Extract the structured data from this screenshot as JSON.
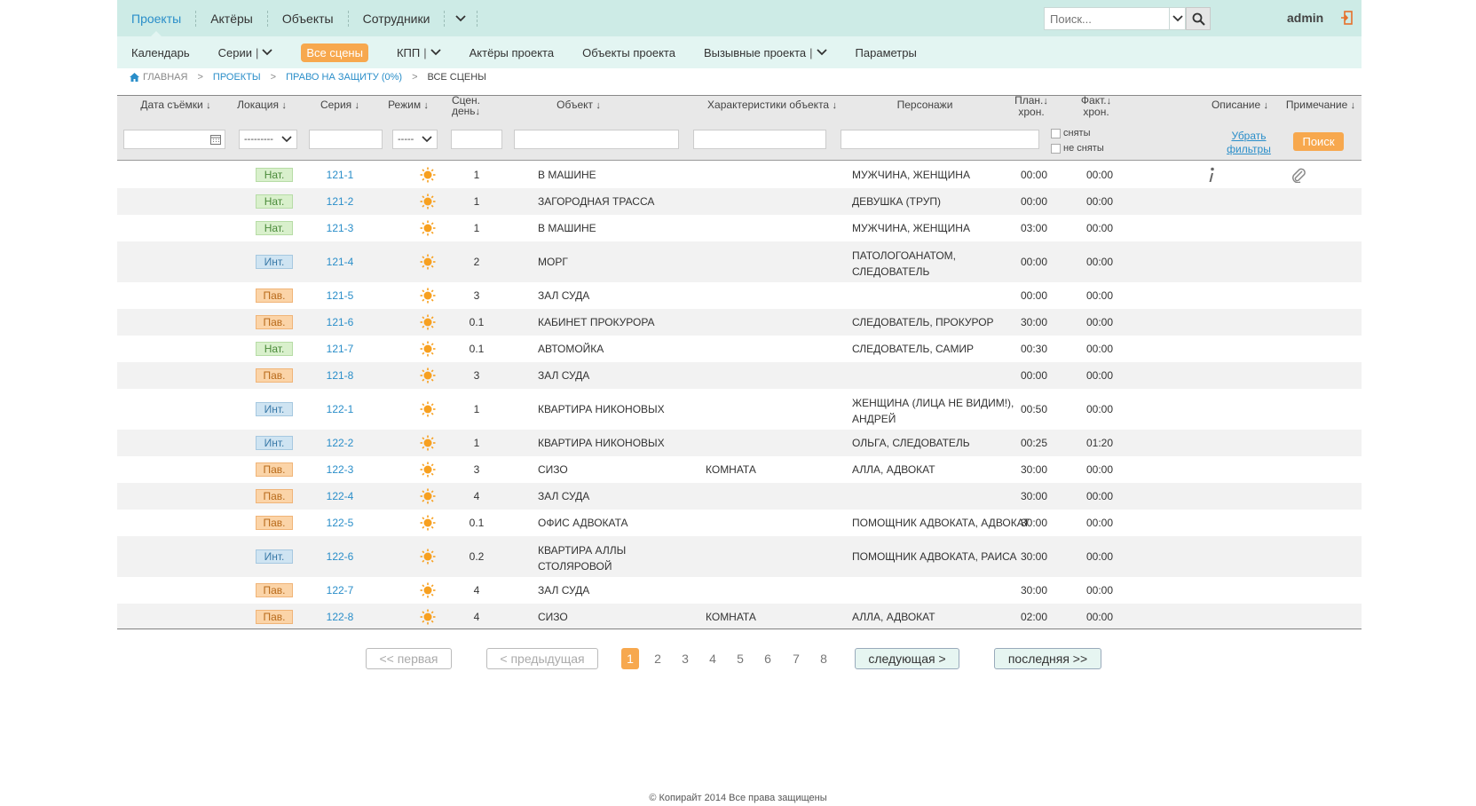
{
  "topnav": {
    "items": [
      "Проекты",
      "Актёры",
      "Объекты",
      "Сотрудники"
    ],
    "search_placeholder": "Поиск...",
    "user": "admin"
  },
  "subnav": {
    "calendar": "Календарь",
    "series": "Серии",
    "all_scenes": "Все сцены",
    "kpp": "КПП",
    "actors": "Актёры проекта",
    "objects": "Объекты проекта",
    "calls": "Вызывные проекта",
    "params": "Параметры"
  },
  "breadcrumb": {
    "home": "ГЛАВНАЯ",
    "projects": "ПРОЕКТЫ",
    "project": "ПРАВО НА ЗАЩИТУ (0%)",
    "current": "ВСЕ СЦЕНЫ"
  },
  "table": {
    "headers": {
      "date": "Дата съёмки",
      "location": "Локация",
      "series": "Серия",
      "mode": "Режим",
      "scene_day_1": "Сцен.",
      "scene_day_2": "день",
      "object": "Объект",
      "object_chars": "Характеристики объекта",
      "characters": "Персонажи",
      "plan_1": "План.",
      "plan_2": "хрон.",
      "fact_1": "Факт.",
      "fact_2": "хрон.",
      "description": "Описание",
      "note": "Примечание"
    },
    "filters": {
      "location_select": "---------",
      "mode_select": "-----",
      "shot": "сняты",
      "not_shot": "не сняты",
      "clear_1": "Убрать",
      "clear_2": "фильтры",
      "search_button": "Поиск"
    },
    "rows": [
      {
        "loc": "Нат.",
        "series": "121-1",
        "day": "1",
        "object": "В МАШИНЕ",
        "object2": "",
        "chars": "",
        "chars_a": "МУЖЧИНА, ЖЕНЩИНА",
        "chars_b": "",
        "plan": "00:00",
        "fact": "00:00"
      },
      {
        "loc": "Нат.",
        "series": "121-2",
        "day": "1",
        "object": "ЗАГОРОДНАЯ ТРАССА",
        "object2": "",
        "chars": "",
        "chars_a": "ДЕВУШКА (ТРУП)",
        "chars_b": "",
        "plan": "00:00",
        "fact": "00:00"
      },
      {
        "loc": "Нат.",
        "series": "121-3",
        "day": "1",
        "object": "В МАШИНЕ",
        "object2": "",
        "chars": "",
        "chars_a": "МУЖЧИНА, ЖЕНЩИНА",
        "chars_b": "",
        "plan": "03:00",
        "fact": "00:00"
      },
      {
        "loc": "Инт.",
        "series": "121-4",
        "day": "2",
        "object": "МОРГ",
        "object2": "",
        "chars": "",
        "chars_a": "ПАТОЛОГОАНАТОМ,",
        "chars_b": "СЛЕДОВАТЕЛЬ",
        "plan": "00:00",
        "fact": "00:00"
      },
      {
        "loc": "Пав.",
        "series": "121-5",
        "day": "3",
        "object": "ЗАЛ СУДА",
        "object2": "",
        "chars": "",
        "chars_a": "",
        "chars_b": "",
        "plan": "00:00",
        "fact": "00:00"
      },
      {
        "loc": "Пав.",
        "series": "121-6",
        "day": "0.1",
        "object": "КАБИНЕТ ПРОКУРОРА",
        "object2": "",
        "chars": "",
        "chars_a": "СЛЕДОВАТЕЛЬ, ПРОКУРОР",
        "chars_b": "",
        "plan": "30:00",
        "fact": "00:00"
      },
      {
        "loc": "Нат.",
        "series": "121-7",
        "day": "0.1",
        "object": "АВТОМОЙКА",
        "object2": "",
        "chars": "",
        "chars_a": "СЛЕДОВАТЕЛЬ, САМИР",
        "chars_b": "",
        "plan": "00:30",
        "fact": "00:00"
      },
      {
        "loc": "Пав.",
        "series": "121-8",
        "day": "3",
        "object": "ЗАЛ СУДА",
        "object2": "",
        "chars": "",
        "chars_a": "",
        "chars_b": "",
        "plan": "00:00",
        "fact": "00:00"
      },
      {
        "loc": "Инт.",
        "series": "122-1",
        "day": "1",
        "object": "КВАРТИРА НИКОНОВЫХ",
        "object2": "",
        "chars": "",
        "chars_a": "ЖЕНЩИНА (ЛИЦА НЕ ВИДИМ!),",
        "chars_b": "АНДРЕЙ",
        "plan": "00:50",
        "fact": "00:00"
      },
      {
        "loc": "Инт.",
        "series": "122-2",
        "day": "1",
        "object": "КВАРТИРА НИКОНОВЫХ",
        "object2": "",
        "chars": "",
        "chars_a": "ОЛЬГА, СЛЕДОВАТЕЛЬ",
        "chars_b": "",
        "plan": "00:25",
        "fact": "01:20"
      },
      {
        "loc": "Пав.",
        "series": "122-3",
        "day": "3",
        "object": "СИЗО",
        "object2": "",
        "chars": "КОМНАТА",
        "chars_a": "АЛЛА, АДВОКАТ",
        "chars_b": "",
        "plan": "30:00",
        "fact": "00:00"
      },
      {
        "loc": "Пав.",
        "series": "122-4",
        "day": "4",
        "object": "ЗАЛ СУДА",
        "object2": "",
        "chars": "",
        "chars_a": "",
        "chars_b": "",
        "plan": "30:00",
        "fact": "00:00"
      },
      {
        "loc": "Пав.",
        "series": "122-5",
        "day": "0.1",
        "object": "ОФИС АДВОКАТА",
        "object2": "",
        "chars": "",
        "chars_a": "ПОМОЩНИК АДВОКАТА, АДВОКАТ",
        "chars_b": "",
        "plan": "30:00",
        "fact": "00:00"
      },
      {
        "loc": "Инт.",
        "series": "122-6",
        "day": "0.2",
        "object": "КВАРТИРА АЛЛЫ",
        "object2": "СТОЛЯРОВОЙ",
        "chars": "",
        "chars_a": "ПОМОЩНИК АДВОКАТА, РАИСА",
        "chars_b": "",
        "plan": "30:00",
        "fact": "00:00"
      },
      {
        "loc": "Пав.",
        "series": "122-7",
        "day": "4",
        "object": "ЗАЛ СУДА",
        "object2": "",
        "chars": "",
        "chars_a": "",
        "chars_b": "",
        "plan": "30:00",
        "fact": "00:00"
      },
      {
        "loc": "Пав.",
        "series": "122-8",
        "day": "4",
        "object": "СИЗО",
        "object2": "",
        "chars": "КОМНАТА",
        "chars_a": "АЛЛА, АДВОКАТ",
        "chars_b": "",
        "plan": "02:00",
        "fact": "00:00"
      }
    ]
  },
  "pagination": {
    "first": "<<  первая",
    "prev": "<  предыдущая",
    "pages": [
      "1",
      "2",
      "3",
      "4",
      "5",
      "6",
      "7",
      "8"
    ],
    "current": "1",
    "next": "следующая  >",
    "last": "последняя  >>"
  },
  "footer": "© Копирайт 2014 Все права защищены",
  "colors": {
    "accent": "#f7a84e",
    "link": "#2a8ec9",
    "topbar": "#cdebe6",
    "subbar": "#e3f5f2"
  }
}
